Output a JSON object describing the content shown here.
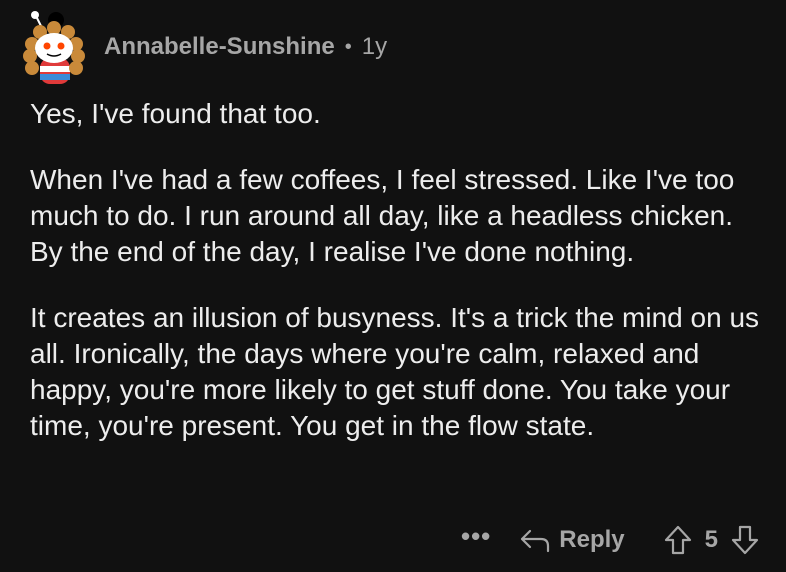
{
  "comment": {
    "author": "Annabelle-Sunshine",
    "separator": "•",
    "age": "1y",
    "paragraphs": [
      "Yes, I've found that too.",
      "When I've had a few coffees, I feel stressed. Like I've too much to do. I run around all day, like a headless chicken. By the end of the day, I realise I've done nothing.",
      "It creates an illusion of busyness. It's a trick the mind on us all. Ironically, the days where you're calm, relaxed and happy, you're more likely to get stuff done. You take your time, you're present. You get in the flow state."
    ],
    "actions": {
      "more_label": "•••",
      "reply_label": "Reply",
      "vote_count": "5"
    }
  },
  "icons": {
    "avatar": "reddit-snoo-avatar",
    "more": "more-options-icon",
    "reply": "reply-arrow-icon",
    "upvote": "upvote-arrow-icon",
    "downvote": "downvote-arrow-icon"
  },
  "colors": {
    "background": "#111111",
    "text": "#ededed",
    "muted": "#a6a6a6"
  }
}
